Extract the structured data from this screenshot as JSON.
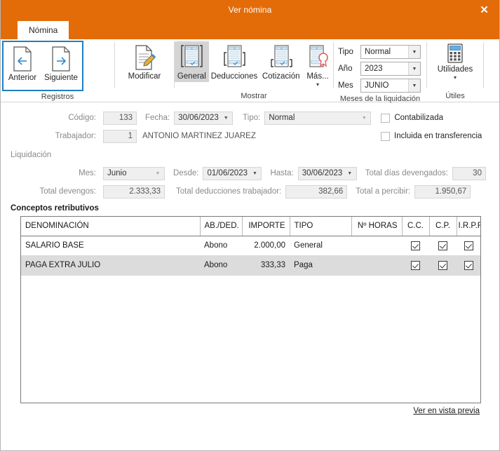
{
  "window": {
    "title": "Ver nómina",
    "close_label": "✕"
  },
  "tabs": [
    {
      "label": "Nómina",
      "active": true
    }
  ],
  "ribbon": {
    "groups": [
      {
        "name": "registros",
        "label": "Registros",
        "buttons": [
          {
            "label": "Anterior",
            "icon": "page-prev-icon"
          },
          {
            "label": "Siguiente",
            "icon": "page-next-icon"
          }
        ]
      },
      {
        "name": "modificar",
        "label": "",
        "buttons": [
          {
            "label": "Modificar",
            "icon": "page-edit-icon"
          }
        ]
      },
      {
        "name": "mostrar",
        "label": "Mostrar",
        "buttons": [
          {
            "label": "General",
            "icon": "report-general-icon",
            "selected": true
          },
          {
            "label": "Deducciones",
            "icon": "report-deductions-icon"
          },
          {
            "label": "Cotización",
            "icon": "report-contribution-icon"
          },
          {
            "label": "Más...",
            "icon": "report-more-icon",
            "has_dropdown": true
          }
        ]
      },
      {
        "name": "meses-liquidacion",
        "label": "Meses de la liquidación",
        "combos": [
          {
            "label": "Tipo",
            "value": "Normal"
          },
          {
            "label": "Año",
            "value": "2023"
          },
          {
            "label": "Mes",
            "value": "JUNIO"
          }
        ]
      },
      {
        "name": "utiles",
        "label": "Útiles",
        "buttons": [
          {
            "label": "Utilidades",
            "icon": "calculator-icon",
            "has_dropdown": true
          }
        ]
      }
    ]
  },
  "form": {
    "codigo_label": "Código:",
    "codigo_value": "133",
    "fecha_label": "Fecha:",
    "fecha_value": "30/06/2023",
    "tipo_label": "Tipo:",
    "tipo_value": "Normal",
    "contabilizada_label": "Contabilizada",
    "contabilizada_checked": false,
    "trabajador_label": "Trabajador:",
    "trabajador_code": "1",
    "trabajador_name": "ANTONIO MARTINEZ JUAREZ",
    "transferencia_label": "Incluida en transferencia",
    "transferencia_checked": false,
    "liquidacion_label": "Liquidación",
    "mes_label": "Mes:",
    "mes_value": "Junio",
    "desde_label": "Desde:",
    "desde_value": "01/06/2023",
    "hasta_label": "Hasta:",
    "hasta_value": "30/06/2023",
    "total_dias_label": "Total días devengados:",
    "total_dias_value": "30",
    "total_devengos_label": "Total devengos:",
    "total_devengos_value": "2.333,33",
    "total_deducciones_label": "Total deducciones trabajador:",
    "total_deducciones_value": "382,66",
    "total_percibir_label": "Total a percibir:",
    "total_percibir_value": "1.950,67"
  },
  "table": {
    "section_title": "Conceptos retributivos",
    "columns": [
      "DENOMINACIÓN",
      "AB./DED.",
      "IMPORTE",
      "TIPO",
      "Nº HORAS",
      "C.C.",
      "C.P.",
      "I.R.P.F."
    ],
    "rows": [
      {
        "denominacion": "SALARIO BASE",
        "ab_ded": "Abono",
        "importe": "2.000,00",
        "tipo": "General",
        "horas": "",
        "cc": true,
        "cp": true,
        "irpf": true
      },
      {
        "denominacion": "PAGA EXTRA JULIO",
        "ab_ded": "Abono",
        "importe": "333,33",
        "tipo": "Paga",
        "horas": "",
        "cc": true,
        "cp": true,
        "irpf": true
      }
    ]
  },
  "footer": {
    "preview_link": "Ver en vista previa"
  },
  "colors": {
    "title_bar": "#E36C09",
    "selection_outline": "#1E7FC4",
    "selected_button_bg": "#D4D4D4",
    "row_alt_bg": "#DCDCDC",
    "readonly_field_bg": "#EFEFEF"
  }
}
